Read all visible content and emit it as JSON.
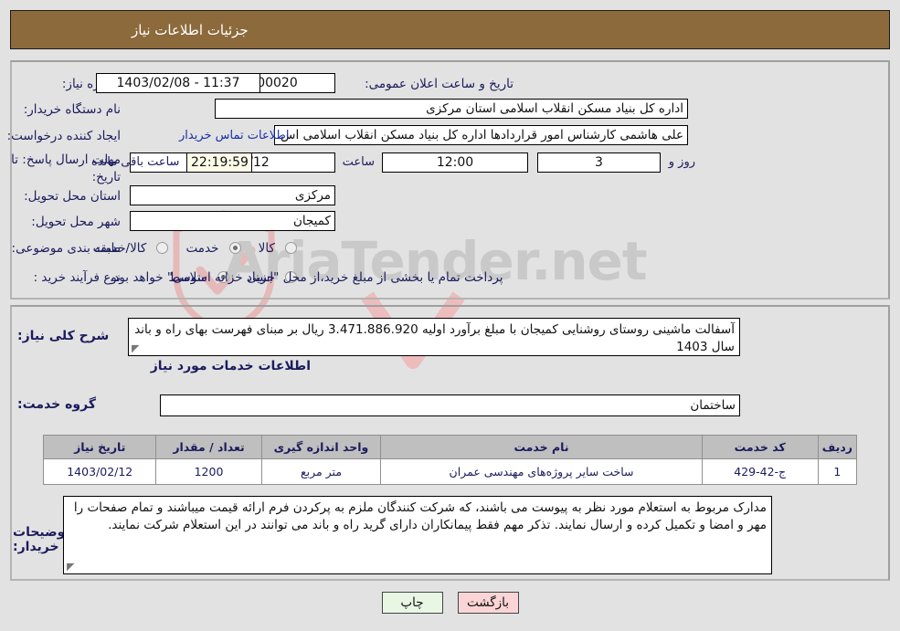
{
  "header": {
    "title": "جزئیات اطلاعات نیاز"
  },
  "form": {
    "need_number": {
      "label": "شماره نیاز:",
      "value": "1103005222000020"
    },
    "public_announce": {
      "label": "تاریخ و ساعت اعلان عمومی:",
      "value": "1403/02/08 - 11:37"
    },
    "buyer_org": {
      "label": "نام دستگاه خریدار:",
      "value": "اداره کل بنیاد مسکن انقلاب اسلامی استان مرکزی"
    },
    "requester": {
      "label": "ایجاد کننده درخواست:",
      "value": "علی هاشمی کارشناس امور قراردادها اداره کل بنیاد مسکن انقلاب اسلامی اس",
      "contact_link": "اطلاعات تماس خریدار"
    },
    "deadline": {
      "label": "مهلت ارسال پاسخ: تا تاریخ:",
      "date": "1403/02/12",
      "time_label": "ساعت",
      "time": "12:00",
      "days": "3",
      "days_label": "روز و",
      "countdown": "22:19:59",
      "remaining_label": "ساعت باقی مانده"
    },
    "province": {
      "label": "استان محل تحویل:",
      "value": "مرکزی"
    },
    "city": {
      "label": "شهر محل تحویل:",
      "value": "کمیجان"
    },
    "category": {
      "label": "طبقه بندی موضوعی:",
      "options": [
        {
          "label": "کالا",
          "selected": false
        },
        {
          "label": "خدمت",
          "selected": true
        },
        {
          "label": "کالا/خدمت",
          "selected": false
        }
      ]
    },
    "purchase_type": {
      "label": "نوع فرآیند خرید :",
      "options": [
        {
          "label": "جزیی",
          "selected": false
        },
        {
          "label": "متوسط",
          "selected": true
        }
      ],
      "note": "پرداخت تمام یا بخشی از مبلغ خرید،از محل \"اسناد خزانه اسلامی\" خواهد بود."
    }
  },
  "description": {
    "label": "شرح کلی نیاز:",
    "text": "آسفالت ماشینی روستای روشنایی کمیجان  با مبلغ برآورد اولیه  3.471.886.920 ریال بر مبنای فهرست بهای راه و باند سال 1403"
  },
  "services_section": {
    "title": "اطلاعات خدمات مورد نیاز"
  },
  "service_group": {
    "label": "گروه خدمت:",
    "value": "ساختمان"
  },
  "table": {
    "columns": [
      "ردیف",
      "کد خدمت",
      "نام خدمت",
      "واحد اندازه گیری",
      "تعداد / مقدار",
      "تاریخ نیاز"
    ],
    "rows": [
      {
        "row": "1",
        "code": "ج-42-429",
        "name": "ساخت سایر پروژه‌های مهندسی عمران",
        "unit": "متر مربع",
        "qty": "1200",
        "date": "1403/02/12"
      }
    ]
  },
  "buyer_notes": {
    "label": "توضیحات خریدار:",
    "text": "مدارک مربوط به استعلام مورد نظر به پیوست می باشند، که شرکت کنندگان ملزم به پرکردن فرم ارائه قیمت میباشند و تمام صفحات را مهر و امضا و تکمیل کرده و ارسال نمایند. تذکر مهم فقط پیمانکاران دارای گرید راه و باند می توانند در این استعلام شرکت نمایند."
  },
  "buttons": {
    "print": "چاپ",
    "back": "بازگشت"
  },
  "watermark": {
    "text": "AriaTender.net"
  },
  "colors": {
    "header_bar": "#8c6a3c",
    "page_bg": "#e2e2e2",
    "label_text": "#1b1b5e",
    "link": "#1b2fa8",
    "table_header_bg": "#bfbfbf",
    "print_btn": "#e8f6e4",
    "back_btn": "#fbd5d5",
    "countdown_bg": "#fcfbe8"
  }
}
